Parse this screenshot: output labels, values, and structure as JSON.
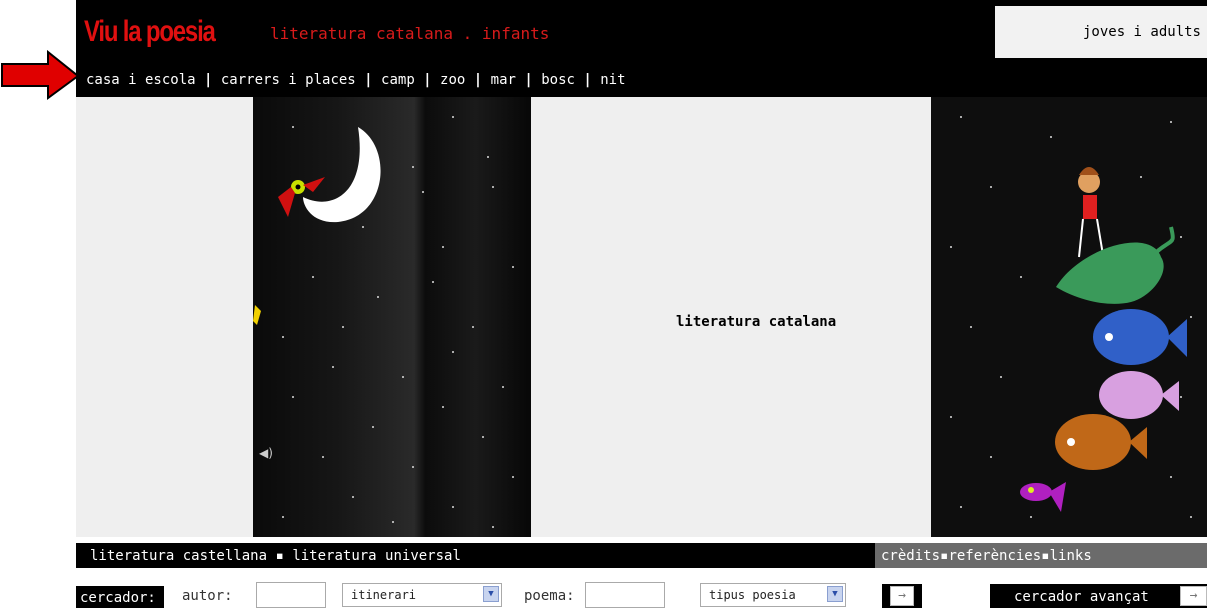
{
  "header": {
    "logo": "Viu la poesia",
    "subtitle": "literatura catalana . infants",
    "audience_link": "joves i adults"
  },
  "nav": {
    "items": [
      "casa i escola",
      "carrers i places",
      "camp",
      "zoo",
      "mar",
      "bosc",
      "nit"
    ]
  },
  "main": {
    "center_title": "literatura catalana"
  },
  "footer": {
    "left_links": [
      "literatura castellana",
      "literatura universal"
    ],
    "right_links": [
      "crèdits",
      "referències",
      "links"
    ]
  },
  "search": {
    "label": "cercador:",
    "author_label": "autor:",
    "itinerary_select": "itinerari",
    "poem_label": "poema:",
    "type_select": "tipus poesia",
    "advanced_label": "cercador avançat"
  },
  "colors": {
    "brand_red": "#e01010",
    "header_bg": "#000000",
    "arrow_red": "#e00000"
  }
}
